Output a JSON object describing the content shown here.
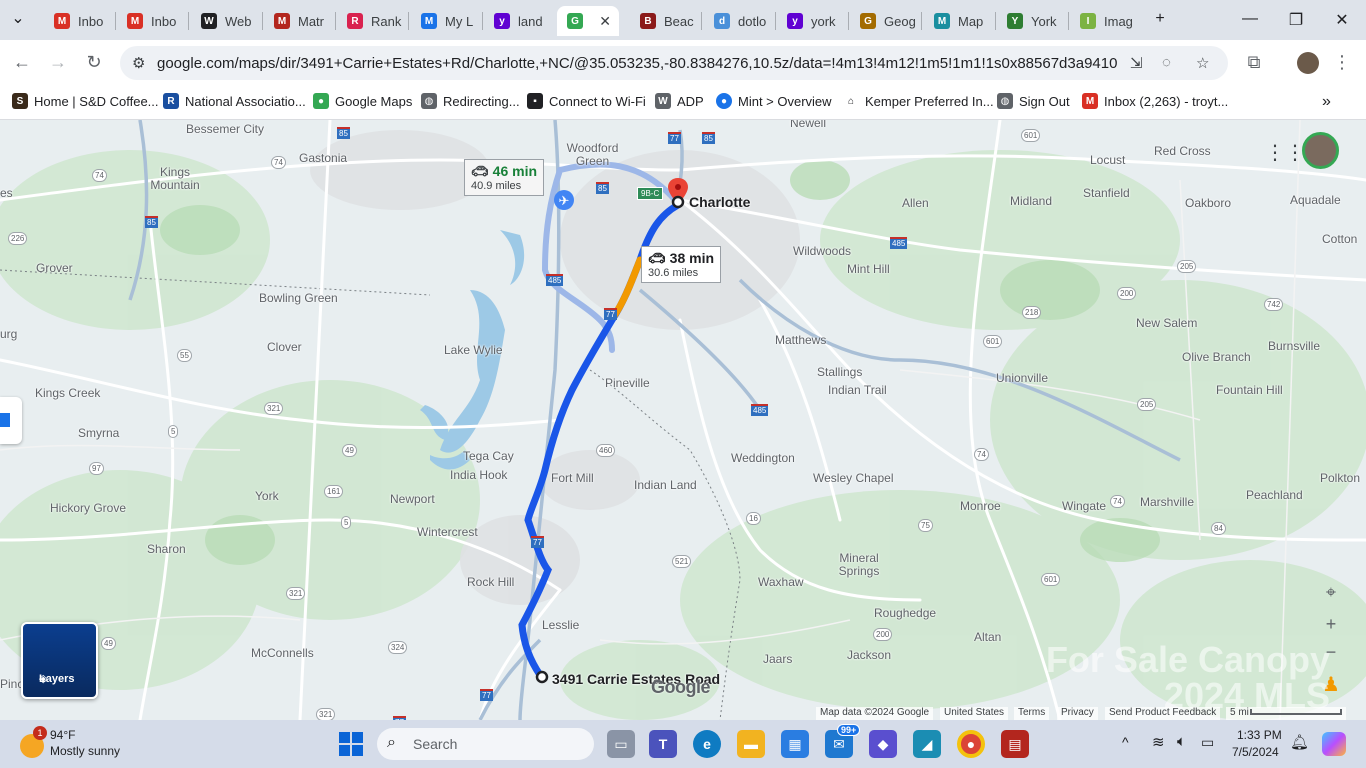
{
  "tabs": [
    {
      "label": "Inbo",
      "color": "#d93025",
      "glyph": "M"
    },
    {
      "label": "Inbo",
      "color": "#d93025",
      "glyph": "M"
    },
    {
      "label": "Web",
      "color": "#202124",
      "glyph": "W"
    },
    {
      "label": "Matr",
      "color": "#b3261e",
      "glyph": "M"
    },
    {
      "label": "Rank",
      "color": "#d9224f",
      "glyph": "R"
    },
    {
      "label": "My L",
      "color": "#1a73e8",
      "glyph": "M"
    },
    {
      "label": "land",
      "color": "#6001d2",
      "glyph": "y"
    },
    {
      "label": "",
      "color": "#34a853",
      "glyph": "G"
    },
    {
      "label": "Beac",
      "color": "#8b1a1a",
      "glyph": "B"
    },
    {
      "label": "dotlo",
      "color": "#4a90d9",
      "glyph": "d"
    },
    {
      "label": "york",
      "color": "#6001d2",
      "glyph": "y"
    },
    {
      "label": "Geog",
      "color": "#a36b00",
      "glyph": "G"
    },
    {
      "label": "Map",
      "color": "#1a8fa0",
      "glyph": "M"
    },
    {
      "label": "York",
      "color": "#2e7d32",
      "glyph": "Y"
    },
    {
      "label": "Imag",
      "color": "#7cb342",
      "glyph": "I"
    }
  ],
  "url": "google.com/maps/dir/3491+Carrie+Estates+Rd/Charlotte,+NC/@35.053235,-80.8384276,10.5z/data=!4m13!4m12!1m5!1m1!1s0x88567d3a94101821:0x3e...",
  "bookmarks": [
    "Home | S&D Coffee...",
    "National Associatio...",
    "Google Maps",
    "Redirecting...",
    "Connect to Wi-Fi",
    "ADP",
    "Mint > Overview",
    "Kemper Preferred In...",
    "Sign Out",
    "Inbox (2,263) - troyt..."
  ],
  "map": {
    "routes": {
      "primary": {
        "time": "38 min",
        "distance": "30.6 miles"
      },
      "alternate": {
        "time": "46 min",
        "distance": "40.9 miles"
      }
    },
    "destination": "Charlotte",
    "origin": "3491 Carrie Estates Road",
    "places": [
      "Bessemer City",
      "Gastonia",
      "Kings Mountain",
      "Woodford Green",
      "Newell",
      "Locust",
      "Red Cross",
      "Stanfield",
      "Oakboro",
      "Aquadale",
      "Allen",
      "Midland",
      "Wildwoods",
      "Mint Hill",
      "Cotton",
      "Grover",
      "Bowling Green",
      "Clover",
      "Lake Wylie",
      "Matthews",
      "Stallings",
      "Indian Trail",
      "Unionville",
      "New Salem",
      "Olive Branch",
      "Burnsville",
      "Fountain Hill",
      "Pineville",
      "Kings Creek",
      "Smyrna",
      "Tega Cay",
      "India Hook",
      "Fort Mill",
      "Weddington",
      "Wesley Chapel",
      "York",
      "Newport",
      "Indian Land",
      "Monroe",
      "Wingate",
      "Marshville",
      "Peachland",
      "Polkton",
      "Hickory Grove",
      "Wintercrest",
      "Sharon",
      "Rock Hill",
      "Mineral Springs",
      "Waxhaw",
      "Lesslie",
      "Roughedge",
      "McConnells",
      "Jaars",
      "Jackson",
      "Altan",
      "Pinc",
      "urg",
      "es"
    ],
    "layers_label": "Layers",
    "attribution": [
      "Map data ©2024 Google",
      "United States",
      "Terms",
      "Privacy",
      "Send Product Feedback",
      "5 mi"
    ],
    "logo": "Google",
    "watermark": "For Sale Canopy 2024 MLS"
  },
  "taskbar": {
    "weather_temp": "94°F",
    "weather_desc": "Mostly sunny",
    "weather_badge": "1",
    "search_placeholder": "Search",
    "mail_badge": "99+",
    "time": "1:33 PM",
    "date": "7/5/2024"
  }
}
